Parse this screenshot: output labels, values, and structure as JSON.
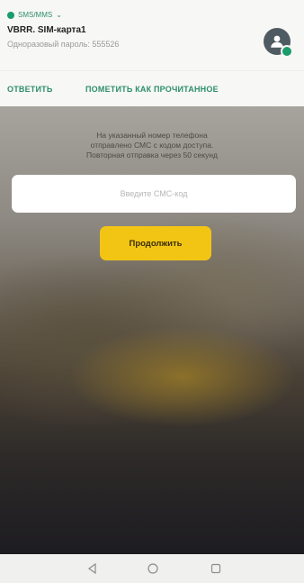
{
  "notification": {
    "app_name": "SMS/MMS",
    "sender": "VBRR. SIM-карта1",
    "body": "Одноразовый пароль: 555526",
    "colors": {
      "accent": "#2e8f6a",
      "avatar_bg": "#4f5b62"
    },
    "icons": {
      "app": "message-dot-icon",
      "expand": "chevron-down-icon",
      "avatar": "person-icon"
    }
  },
  "actions": {
    "reply": "ОТВЕТИТЬ",
    "mark_read": "ПОМЕТИТЬ КАК ПРОЧИТАННОЕ"
  },
  "form": {
    "message_line1": "На указанный номер телефона",
    "message_line2": "отправлено СМС с кодом доступа.",
    "message_line3": "Повторная отправка через 50 секунд",
    "sms_placeholder": "Введите СМС-код",
    "continue_label": "Продолжить",
    "colors": {
      "button": "#f2c515"
    }
  },
  "navbar": {
    "icons": [
      "back-triangle-icon",
      "home-circle-icon",
      "recents-square-icon"
    ]
  }
}
